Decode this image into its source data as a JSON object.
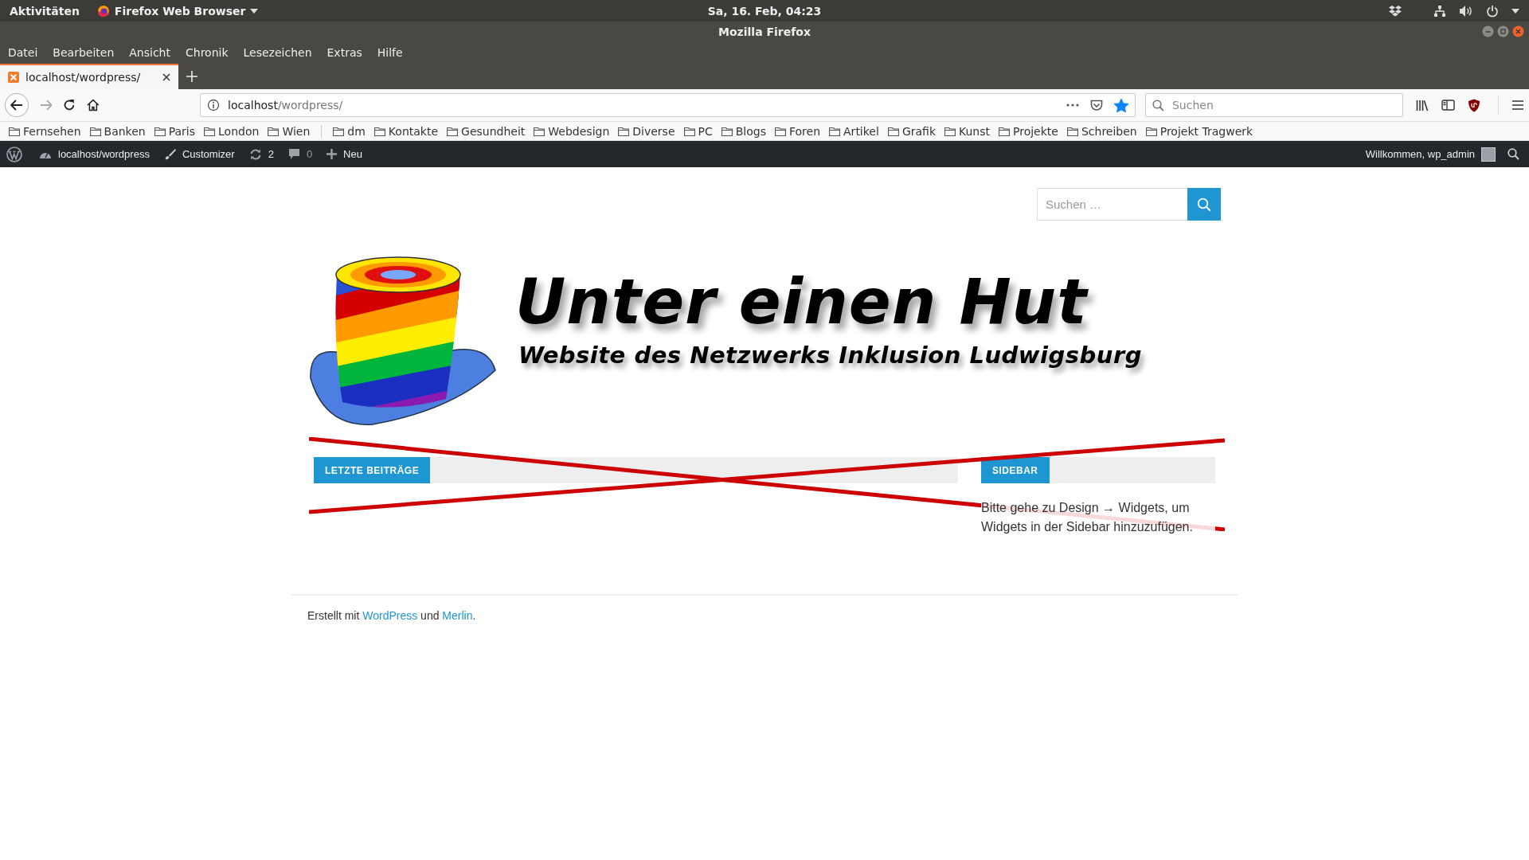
{
  "desktop_bar": {
    "activities": "Aktivitäten",
    "app_menu": "Firefox Web Browser",
    "clock": "Sa, 16. Feb, 04:23"
  },
  "window": {
    "title": "Mozilla Firefox"
  },
  "menu_bar": [
    "Datei",
    "Bearbeiten",
    "Ansicht",
    "Chronik",
    "Lesezeichen",
    "Extras",
    "Hilfe"
  ],
  "tabs": [
    {
      "title": "localhost/wordpress/",
      "selected": true
    }
  ],
  "address_bar": {
    "host": "localhost",
    "path": "/wordpress/",
    "starred": true
  },
  "browser_search": {
    "placeholder": "Suchen"
  },
  "bookmarks": [
    {
      "kind": "folder",
      "label": "Fernsehen"
    },
    {
      "kind": "folder",
      "label": "Banken"
    },
    {
      "kind": "folder",
      "label": "Paris"
    },
    {
      "kind": "folder",
      "label": "London"
    },
    {
      "kind": "folder",
      "label": "Wien"
    },
    {
      "kind": "separator"
    },
    {
      "kind": "folder",
      "label": "dm"
    },
    {
      "kind": "folder",
      "label": "Kontakte"
    },
    {
      "kind": "folder",
      "label": "Gesundheit"
    },
    {
      "kind": "folder",
      "label": "Webdesign"
    },
    {
      "kind": "folder",
      "label": "Diverse"
    },
    {
      "kind": "folder",
      "label": "PC"
    },
    {
      "kind": "folder",
      "label": "Blogs"
    },
    {
      "kind": "folder",
      "label": "Foren"
    },
    {
      "kind": "folder",
      "label": "Artikel"
    },
    {
      "kind": "folder",
      "label": "Grafik"
    },
    {
      "kind": "folder",
      "label": "Kunst"
    },
    {
      "kind": "folder",
      "label": "Projekte"
    },
    {
      "kind": "folder",
      "label": "Schreiben"
    },
    {
      "kind": "folder",
      "label": "Projekt Tragwerk"
    }
  ],
  "admin_bar": {
    "site": "localhost/wordpress",
    "customizer": "Customizer",
    "updates": "2",
    "comments": "0",
    "new": "Neu",
    "greeting": "Willkommen, wp_admin"
  },
  "page": {
    "search_placeholder": "Suchen …",
    "site_title": "Unter einen Hut",
    "tagline": "Website des Netzwerks Inklusion Ludwigsburg",
    "sections": [
      {
        "heading": "LETZTE BEITRÄGE"
      },
      {
        "heading": "SIDEBAR",
        "text": "Bitte gehe zu Design → Widgets, um Widgets in der Sidebar hinzuzufügen."
      }
    ],
    "footer": [
      {
        "kind": "text",
        "text": "Erstellt mit "
      },
      {
        "kind": "link",
        "text": "WordPress"
      },
      {
        "kind": "text",
        "text": " und "
      },
      {
        "kind": "link",
        "text": "Merlin"
      },
      {
        "kind": "text",
        "text": "."
      }
    ]
  }
}
